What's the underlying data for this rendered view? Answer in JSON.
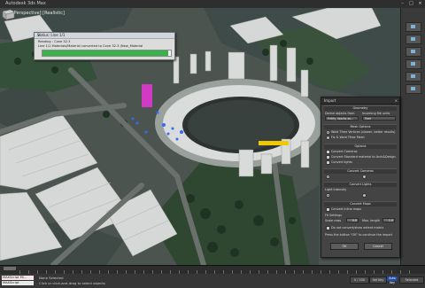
{
  "app": {
    "title": "Autodesk 3ds Max"
  },
  "viewport": {
    "label": "[+] [Perspective] [Realistic]",
    "highlight_label": ""
  },
  "progress_dialog": {
    "title": "Status: Line 1/1",
    "line1": "Reading : Cone 32.3",
    "line2": "Line 1/1 Materials/Material converted to Cone 32.3 (New_Material",
    "progress": 0.98
  },
  "import_dialog": {
    "title": "Import",
    "geometry_label": "Geometry",
    "units_label": "Incoming file units",
    "units_value": "Feet",
    "by_layer_label": "Derive objects from",
    "by_layer_value": "Entity, blocks as...",
    "sections": [
      "Mesh Options",
      "Options",
      "Convert Cameras",
      "Convert Lights",
      "Convert Maps"
    ],
    "mesh_options": [
      "Weld Tfree Vertices (slower, better results)",
      "Fix & Weld Tfree Mesh"
    ],
    "options": [
      "Convert Cameras",
      "Convert Standard material to Arch&Design",
      "Convert lights"
    ],
    "lights_label": "Light Intensity",
    "maps": [
      "Convert inline maps",
      "Convert maps"
    ],
    "fit_label": "Fit Settings",
    "scale_label": "Scale rows",
    "scale_value": "0.0",
    "length_label": "Max. length",
    "length_value": "1.0",
    "check_bottom": "Do not convert/show extent matrix",
    "note": "Press the button \"OK\" to continue the import",
    "ok_label": "OK",
    "cancel_label": "Cancel"
  },
  "statusbar": {
    "maxscript_line1": "MAXScript Mi...",
    "maxscript_line2": "MAXScript",
    "msg1": "None Selected",
    "msg2": "Click or click-and-drag to select objects",
    "autokey": "Auto Key",
    "selected": "Selected",
    "set_key": "Set Key",
    "frame": "0 / 100"
  }
}
